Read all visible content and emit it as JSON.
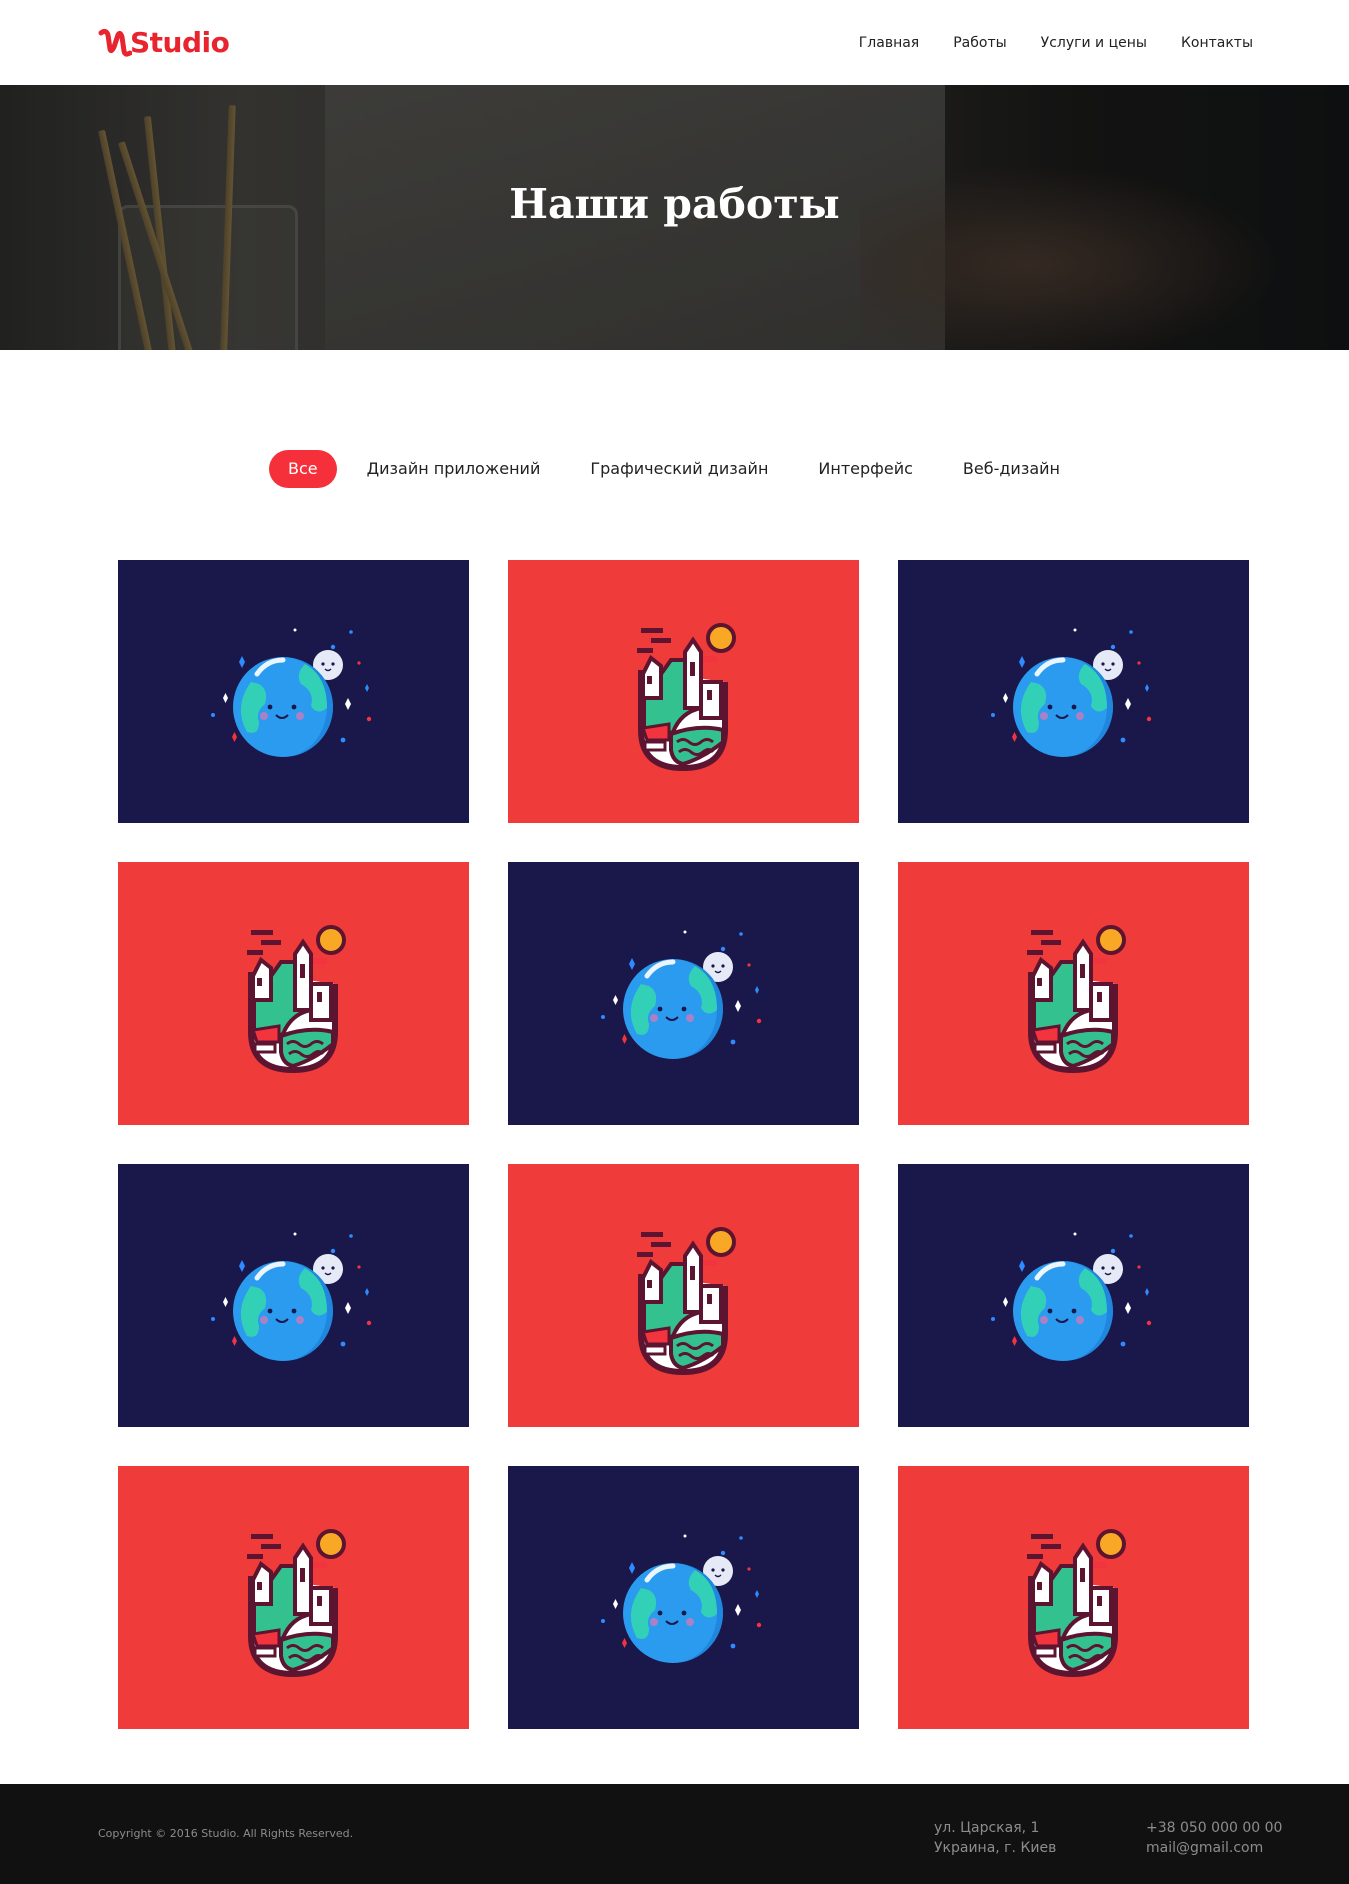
{
  "header": {
    "logo_text": "Studio",
    "nav": [
      "Главная",
      "Работы",
      "Услуги и цены",
      "Контакты"
    ]
  },
  "hero": {
    "title": "Наши работы"
  },
  "filters": {
    "items": [
      "Все",
      "Дизайн приложений",
      "Графический дизайн",
      "Интерфейс",
      "Веб-дизайн"
    ],
    "active": "Все"
  },
  "portfolio": {
    "items": [
      {
        "illustration": "planet-icon",
        "background": "#1a174a"
      },
      {
        "illustration": "city-icon",
        "background": "#ef3b39"
      },
      {
        "illustration": "planet-icon",
        "background": "#1a174a"
      },
      {
        "illustration": "city-icon",
        "background": "#ef3b39"
      },
      {
        "illustration": "planet-icon",
        "background": "#1a174a"
      },
      {
        "illustration": "city-icon",
        "background": "#ef3b39"
      },
      {
        "illustration": "planet-icon",
        "background": "#1a174a"
      },
      {
        "illustration": "city-icon",
        "background": "#ef3b39"
      },
      {
        "illustration": "planet-icon",
        "background": "#1a174a"
      },
      {
        "illustration": "city-icon",
        "background": "#ef3b39"
      },
      {
        "illustration": "planet-icon",
        "background": "#1a174a"
      },
      {
        "illustration": "city-icon",
        "background": "#ef3b39"
      }
    ]
  },
  "footer": {
    "copyright": "Copyright © 2016 Studio. All Rights Reserved.",
    "address_line1": "ул. Царская, 1",
    "address_line2": "Украина, г. Киев",
    "phone": "+38 050 000 00 00",
    "email": "mail@gmail.com"
  },
  "colors": {
    "accent": "#f5303a",
    "navy": "#1a174a",
    "red": "#ef3b39",
    "footer_bg": "#111111"
  }
}
